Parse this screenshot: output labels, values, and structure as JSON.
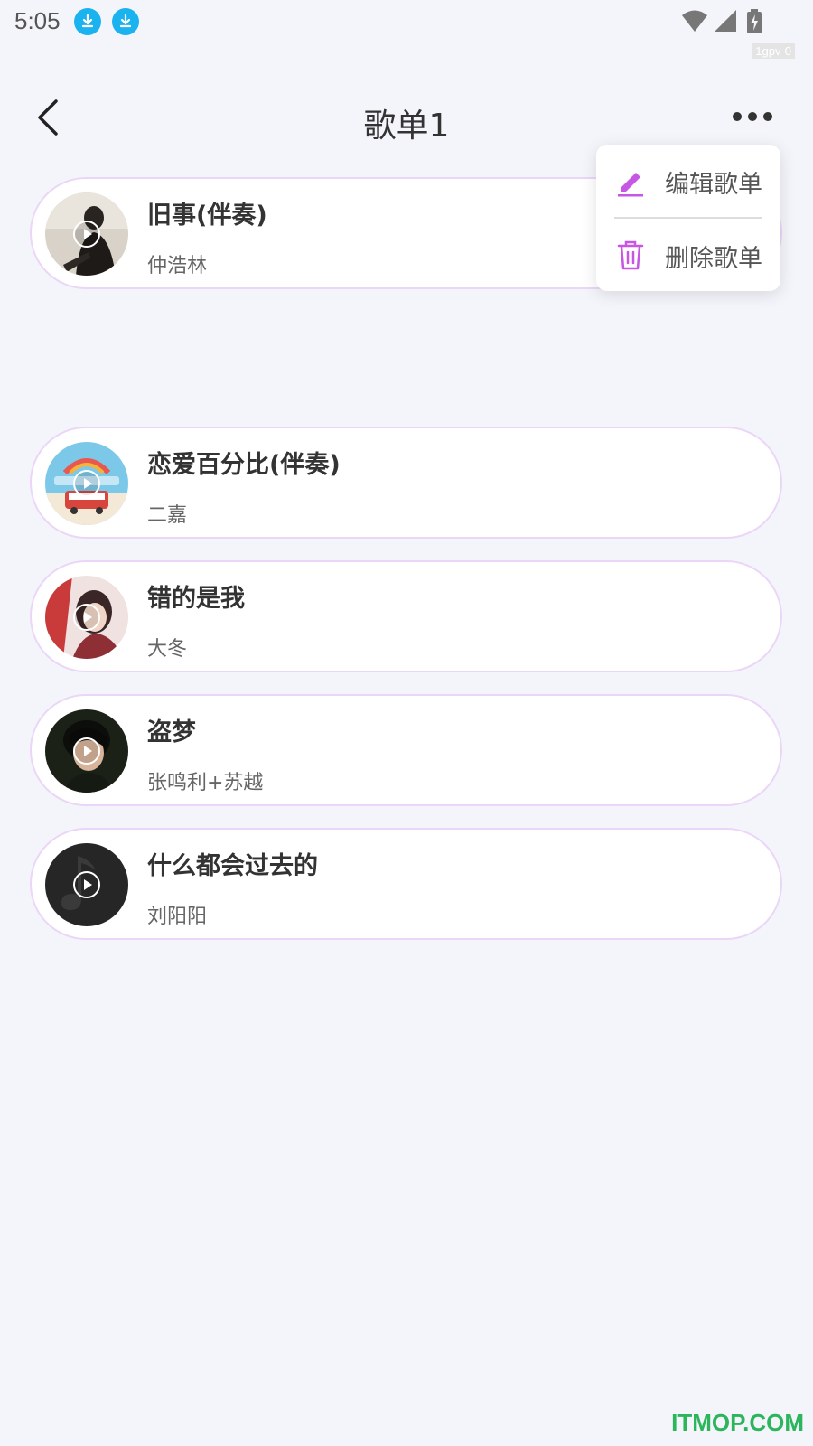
{
  "status_bar": {
    "time": "5:05",
    "tag": "1gpv-0",
    "icons": [
      "download-icon",
      "download-icon",
      "wifi-icon",
      "signal-icon",
      "battery-charging-icon"
    ]
  },
  "header": {
    "title": "歌单1",
    "back_icon": "chevron-left-icon",
    "more_icon": "more-horizontal-icon"
  },
  "menu": {
    "items": [
      {
        "label": "编辑歌单",
        "icon": "edit-pencil-icon"
      },
      {
        "label": "删除歌单",
        "icon": "trash-icon"
      }
    ],
    "accent": "#c757e3"
  },
  "songs": [
    {
      "title": "旧事(伴奏)",
      "artist": "仲浩林"
    },
    {
      "title": "恋爱百分比(伴奏)",
      "artist": "二嘉"
    },
    {
      "title": "错的是我",
      "artist": "大冬"
    },
    {
      "title": "盗梦",
      "artist": "张鸣利+苏越"
    },
    {
      "title": "什么都会过去的",
      "artist": "刘阳阳"
    }
  ],
  "watermark": "ITMOP.COM",
  "colors": {
    "background": "#f4f5fa",
    "card_border": "#ecd6f7",
    "download_badge": "#1ab3f0"
  }
}
